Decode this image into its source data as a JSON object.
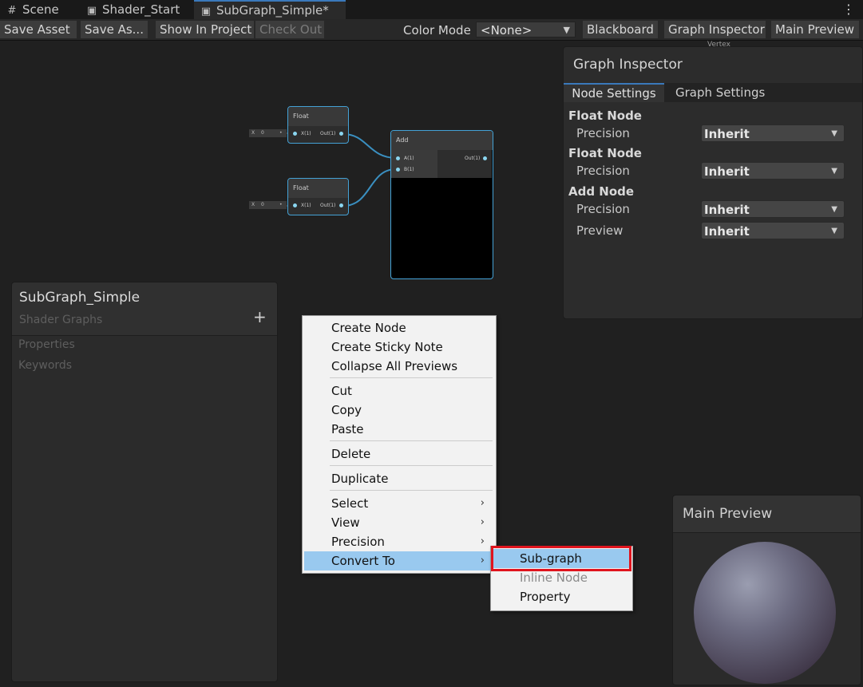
{
  "tabs": [
    {
      "label": "Scene",
      "icon": "grid-icon"
    },
    {
      "label": "Shader_Start",
      "icon": "shader-graph-icon"
    },
    {
      "label": "SubGraph_Simple*",
      "icon": "shader-graph-icon"
    }
  ],
  "toolbar": {
    "save_asset": "Save Asset",
    "save_as": "Save As...",
    "show_in_project": "Show In Project",
    "check_out": "Check Out",
    "color_mode_label": "Color Mode",
    "color_mode_value": "<None>",
    "blackboard": "Blackboard",
    "graph_inspector": "Graph Inspector",
    "main_preview": "Main Preview"
  },
  "nodes": {
    "float1": {
      "title": "Float",
      "in_port": "X(1)",
      "out_port": "Out(1)",
      "field_label": "X",
      "field_value": "0"
    },
    "float2": {
      "title": "Float",
      "in_port": "X(1)",
      "out_port": "Out(1)",
      "field_label": "X",
      "field_value": "0"
    },
    "add": {
      "title": "Add",
      "in_a": "A(1)",
      "in_b": "B(1)",
      "out_port": "Out(1)"
    }
  },
  "inspector": {
    "title": "Graph Inspector",
    "tab_node": "Node Settings",
    "tab_graph": "Graph Settings",
    "peek_label": "Vertex",
    "sections": [
      {
        "header": "Float Node",
        "rows": [
          {
            "label": "Precision",
            "value": "Inherit"
          }
        ]
      },
      {
        "header": "Float Node",
        "rows": [
          {
            "label": "Precision",
            "value": "Inherit"
          }
        ]
      },
      {
        "header": "Add Node",
        "rows": [
          {
            "label": "Precision",
            "value": "Inherit"
          },
          {
            "label": "Preview",
            "value": "Inherit"
          }
        ]
      }
    ]
  },
  "blackboard": {
    "title": "SubGraph_Simple",
    "subtitle": "Shader Graphs",
    "add": "+",
    "properties": "Properties",
    "keywords": "Keywords"
  },
  "preview": {
    "title": "Main Preview"
  },
  "context_menu": {
    "items": [
      "Create Node",
      "Create Sticky Note",
      "Collapse All Previews",
      "Cut",
      "Copy",
      "Paste",
      "Delete",
      "Duplicate",
      "Select",
      "View",
      "Precision",
      "Convert To"
    ],
    "submenu_arrow": "›"
  },
  "submenu": {
    "items": [
      "Sub-graph",
      "Inline Node",
      "Property"
    ],
    "highlight_color": "#e0141e"
  }
}
